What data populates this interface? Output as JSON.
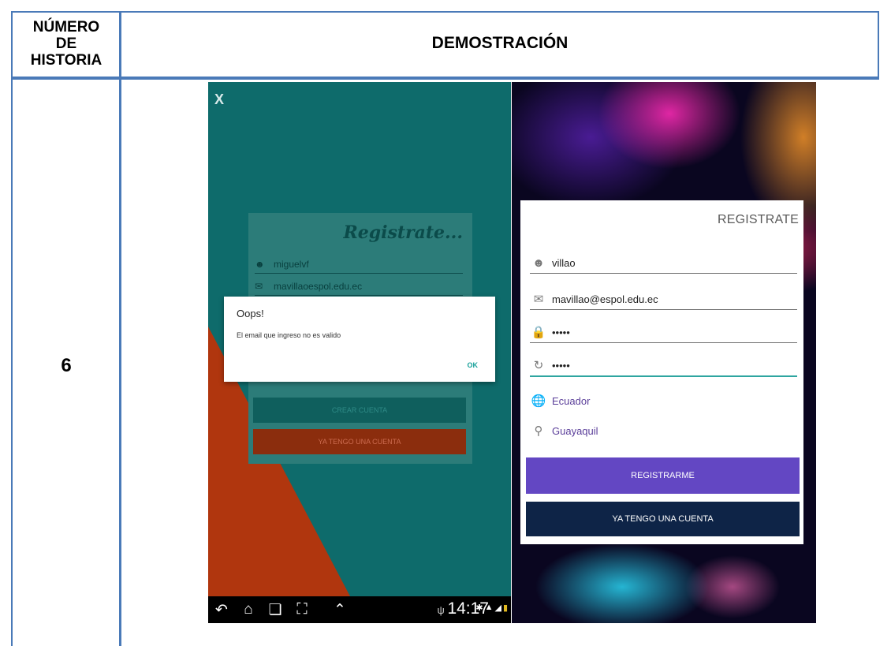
{
  "table": {
    "header_story": [
      "NÚMERO",
      "DE",
      "HISTORIA"
    ],
    "header_demo": "DEMOSTRACIÓN",
    "story_number": "6"
  },
  "left_screen": {
    "close_label": "X",
    "form_title": "Registrate...",
    "username": "miguelvf",
    "email": "mavillaoespol.edu.ec",
    "create_button": "CREAR CUENTA",
    "have_account_button": "YA TENGO UNA CUENTA",
    "dialog": {
      "title": "Oops!",
      "message": "El email que ingreso no es valido",
      "ok": "OK"
    },
    "status_bar": {
      "time": "14:17"
    }
  },
  "right_screen": {
    "title": "REGISTRATE",
    "username": "villao",
    "email": "mavillao@espol.edu.ec",
    "password": "•••••",
    "confirm_password": "•••••",
    "country": "Ecuador",
    "city": "Guayaquil",
    "register_button": "REGISTRARME",
    "have_account_button": "YA TENGO UNA CUENTA"
  },
  "colors": {
    "border": "#4a7ab8",
    "teal_bg": "#0e6b6b",
    "orange": "#8b2d0d",
    "purple_button": "#6347c3",
    "navy_button": "#0e2447",
    "active_field": "#2ea5a0"
  }
}
